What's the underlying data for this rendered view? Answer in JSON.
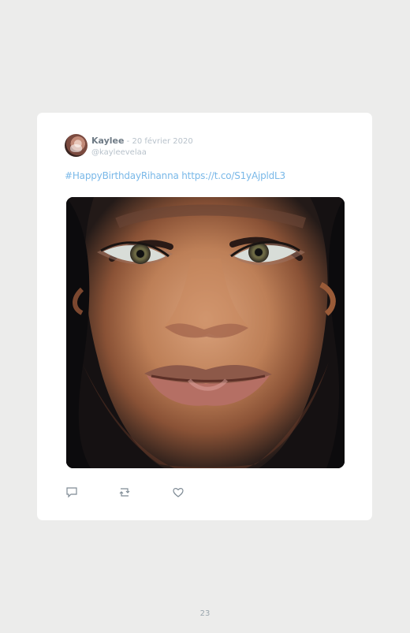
{
  "tweet": {
    "author_name": "Kaylee",
    "separator": " - ",
    "date": "20 février 2020",
    "handle": "@kayleevelaa",
    "hashtag": "#HappyBirthdayRihanna",
    "link": "https://t.co/S1yAjpldL3"
  },
  "actions": {
    "reply_icon": "reply-icon",
    "retweet_icon": "retweet-icon",
    "like_icon": "heart-icon"
  },
  "colors": {
    "background": "#ececeb",
    "card": "#ffffff",
    "link": "#79b8e8",
    "name": "#6f7b86",
    "muted": "#b8c2cb"
  },
  "page": {
    "number": "23"
  }
}
